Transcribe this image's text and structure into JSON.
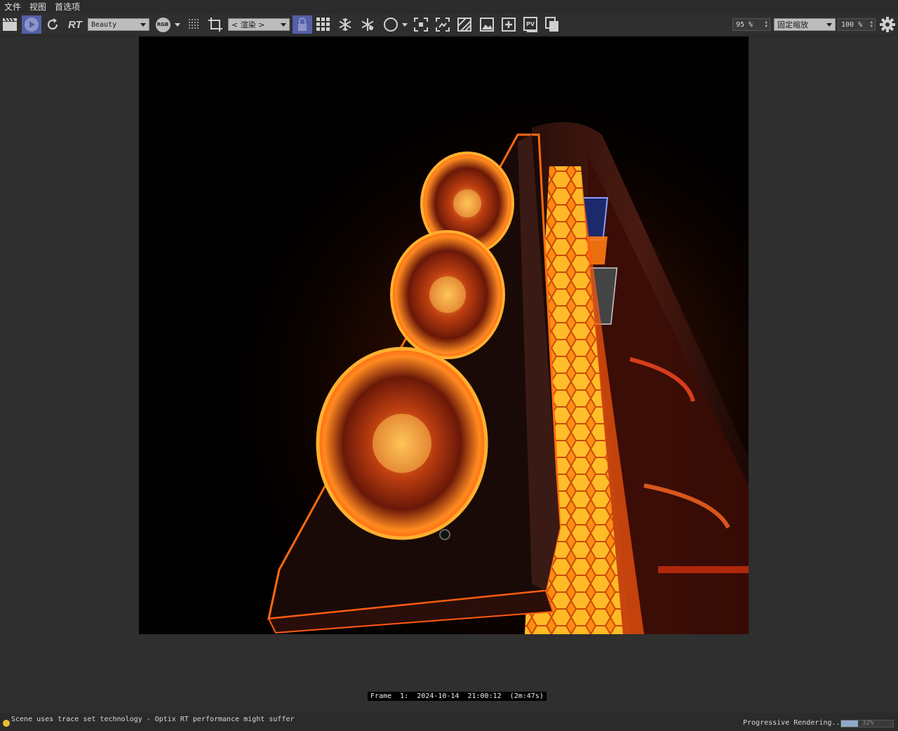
{
  "menu": {
    "file": "文件",
    "view": "视图",
    "preferences": "首选项"
  },
  "toolbar": {
    "rt_label": "RT",
    "pass_select": "Beauty",
    "channel_badge": "RGB",
    "render_region_select": "< 渲染 >",
    "zoom_value": "95 %",
    "scale_mode_select": "固定缩放",
    "exposure_value": "100 %",
    "icons": [
      "clapper-icon",
      "play-render-icon",
      "refresh-icon",
      "rt-icon",
      "rgb-icon",
      "dots-grid-icon",
      "crop-icon",
      "lock-icon",
      "grid-icon",
      "snowflake-icon",
      "snowflake-alt-icon",
      "circle-icon",
      "focus-icon",
      "frame-icon",
      "stripes-icon",
      "image-icon",
      "add-icon",
      "pv-icon",
      "copy-icon",
      "gear-icon"
    ]
  },
  "colors": {
    "accent": "#5560a8",
    "background": "#2f2f2f",
    "glow_orange": "#ff6a10",
    "glow_yellow": "#ffb020",
    "status_dot": "#e8c033",
    "progress": "#8fa8c8"
  },
  "frame_info": "Frame  1:  2024-10-14  21:00:12  (2m:47s)",
  "status": {
    "message": "Scene uses trace set technology - Optix RT performance might suffer",
    "progressive": "Progressive Rendering...",
    "progress_percent": 32,
    "progress_text": "32%"
  }
}
